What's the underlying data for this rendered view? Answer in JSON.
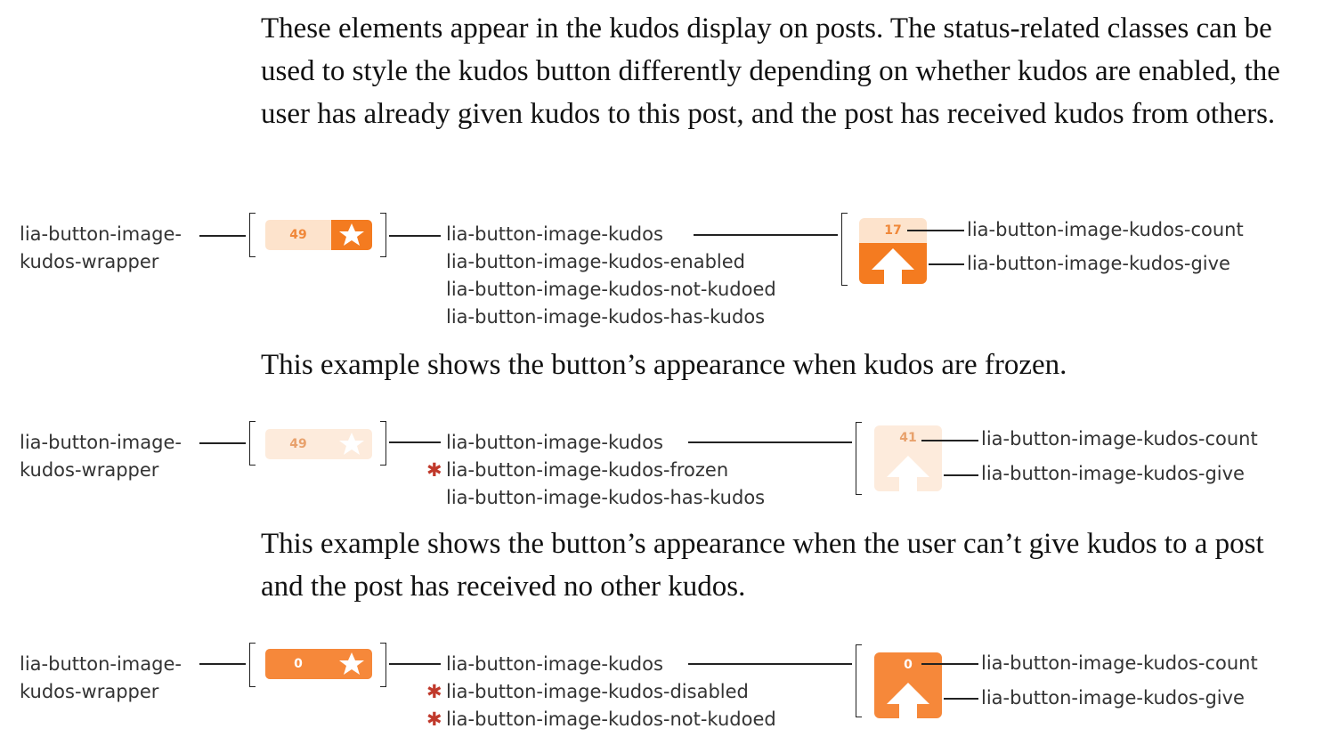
{
  "paragraphs": {
    "intro": "These elements appear in the kudos display on posts. The status-related classes can be used to style the kudos button differently depending on whether kudos are enabled, the user has already given kudos to this post, and the post has received kudos from others.",
    "frozen": "This example shows the button’s appearance when kudos are frozen.",
    "disabled": "This example shows the button’s appearance when the user can’t give kudos to a post and the post has received no other kudos."
  },
  "wrapper_label": [
    "lia-button-image-",
    "kudos-wrapper"
  ],
  "examples": [
    {
      "state": "enabled",
      "pill_count": "49",
      "box_count": "17",
      "classes": [
        "lia-button-image-kudos",
        "lia-button-image-kudos-enabled",
        "lia-button-image-kudos-not-kudoed",
        "lia-button-image-kudos-has-kudos"
      ],
      "asterisks": [
        false,
        false,
        false,
        false
      ],
      "count_label": "lia-button-image-kudos-count",
      "give_label": "lia-button-image-kudos-give"
    },
    {
      "state": "frozen",
      "pill_count": "49",
      "box_count": "41",
      "classes": [
        "lia-button-image-kudos",
        "lia-button-image-kudos-frozen",
        "lia-button-image-kudos-has-kudos"
      ],
      "asterisks": [
        false,
        true,
        false
      ],
      "count_label": "lia-button-image-kudos-count",
      "give_label": "lia-button-image-kudos-give"
    },
    {
      "state": "disabled",
      "pill_count": "0",
      "box_count": "0",
      "classes": [
        "lia-button-image-kudos",
        "lia-button-image-kudos-disabled",
        "lia-button-image-kudos-not-kudoed"
      ],
      "asterisks": [
        false,
        true,
        true
      ],
      "count_label": "lia-button-image-kudos-count",
      "give_label": "lia-button-image-kudos-give"
    }
  ],
  "asterisk_symbol": "✱",
  "colors": {
    "enabled_count_bg": "#fde3cc",
    "enabled_count_text": "#f0883a",
    "enabled_give_bg": "#f47b20",
    "frozen_bg": "#fdebdc",
    "frozen_text": "#e8a16c",
    "disabled_bg": "#f6883a",
    "disabled_text": "#ffffff"
  }
}
